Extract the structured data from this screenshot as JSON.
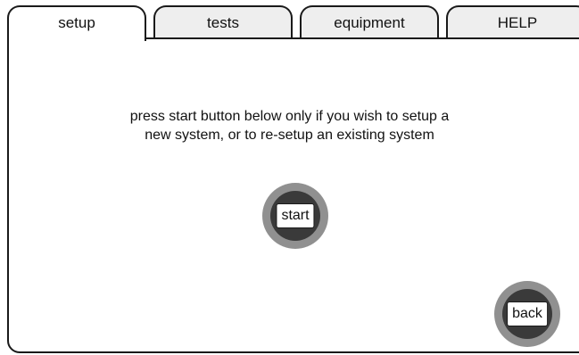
{
  "tabs": [
    {
      "label": "setup",
      "active": true
    },
    {
      "label": "tests",
      "active": false
    },
    {
      "label": "equipment",
      "active": false
    },
    {
      "label": "HELP",
      "active": false
    }
  ],
  "main": {
    "instructions": "press start button below only if you wish to setup a\nnew system, or to re-setup an existing system",
    "start_label": "start",
    "back_label": "back"
  },
  "colors": {
    "button_ring": "#909090",
    "button_core": "#3a3a3a",
    "inactive_tab": "#eeeeee",
    "outline": "#1a1a1a"
  }
}
